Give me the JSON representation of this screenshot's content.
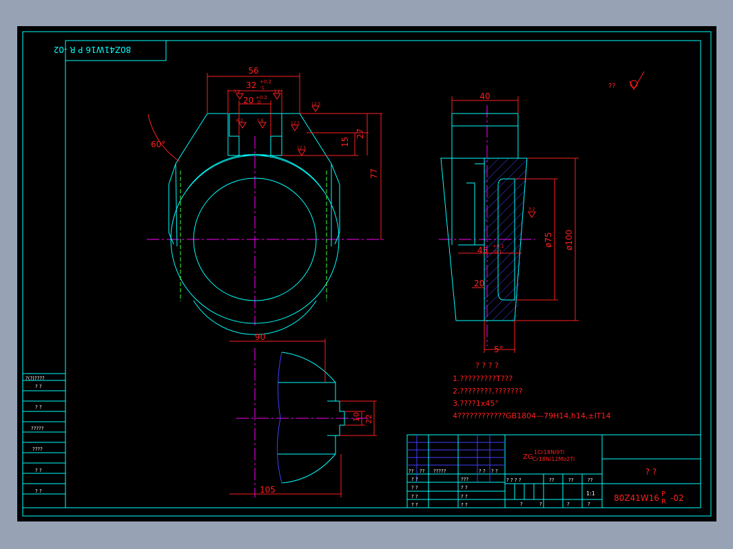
{
  "title_stamp": "80Z41W16 P R -02",
  "title_stamp_main": "80Z41W16",
  "title_stamp_p": "P",
  "title_stamp_r": "R",
  "title_stamp_suffix": "-02",
  "surface_note": "??",
  "colors": {
    "background": "#000000",
    "frame": "#00ffff",
    "dimension": "#ff2020",
    "centerline": "#ff00ff",
    "hidden": "#40ff40",
    "hatch": "#4040ff",
    "outer_bg": "#97a3b5"
  },
  "dimensions": {
    "d56": "56",
    "d32": "32",
    "d32_tol_up": "+0.2",
    "d32_tol_lo": "-1",
    "d20": "20",
    "d20_tol_up": "+0.2",
    "d20_tol_lo": "0",
    "d60": "60°",
    "d27": "27",
    "d15": "15",
    "d77": "77",
    "d40": "40",
    "d45": "45",
    "d45_tol_up": "+0.1",
    "d45_tol_lo": "-0.1",
    "d75": "ø75",
    "d100": "ø100",
    "d20b": "20",
    "d5": "5°",
    "d90": "90",
    "d105": "105",
    "d10": "10",
    "d22": "22",
    "rough_12_5": "12.5",
    "rough_3_2": "3.2",
    "rough_1_6": "1.6",
    "rough_6_3": "6.3"
  },
  "notes": {
    "heading": "? ? ? ?",
    "line1": "1.?????????T???",
    "line2": "2.????????,???????",
    "line3": "3.????1x45°",
    "line4": "4????????????GB1804—79H14,h14,±IT14"
  },
  "left_strip": {
    "header": "?(?)????",
    "rows": [
      "?   ?",
      "?   ?",
      "?????",
      "????",
      "?   ?",
      "?   ?"
    ]
  },
  "title_block": {
    "material_prefix": "ZG",
    "material_top": "1Cr18Ni9Ti",
    "material_bottom": "Cr18Ni12Mo2Ti",
    "part_name": "?   ?",
    "drawing_no": "80Z41W16",
    "drawing_no_p": "P",
    "drawing_no_r": "R",
    "drawing_no_suffix": "-02",
    "scale": "1:1",
    "sign_header": [
      "??",
      "??",
      "?????",
      "?  ?",
      "?  ?"
    ],
    "sign_rows": [
      "?  ?",
      "?  ?",
      "?  ?",
      "?  ?"
    ],
    "sign_rows_b": [
      "???",
      "?  ?",
      "?  ?",
      "?  ?"
    ],
    "stage_header": [
      "?  ?  ?  ?",
      "??",
      "??",
      "??"
    ],
    "bottom_cells": [
      "?",
      "?",
      "?",
      "?"
    ]
  }
}
